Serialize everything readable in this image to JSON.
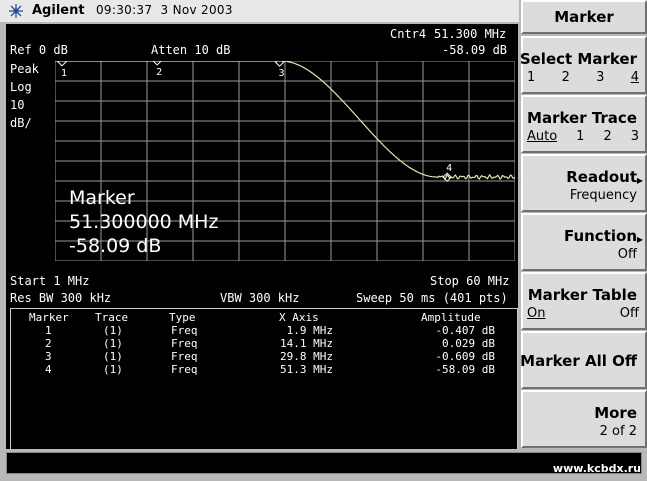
{
  "header": {
    "brand": "Agilent",
    "time": "09:30:37",
    "date": "3 Nov 2003"
  },
  "display": {
    "ref_level": "Ref 0 dB",
    "atten": "Atten 10 dB",
    "scale_type": "Peak",
    "scale_mode": "Log",
    "scale_value": "10",
    "scale_unit": "dB/",
    "active_marker_label": "Cntr4",
    "active_marker_freq": "51.300 MHz",
    "active_marker_amp": "-58.09 dB",
    "marker_readout_title": "Marker",
    "marker_readout_freq": "51.300000 MHz",
    "marker_readout_amp": "-58.09 dB",
    "start_freq": "Start 1 MHz",
    "stop_freq": "Stop 60 MHz",
    "res_bw": "Res BW 300 kHz",
    "vbw": "VBW 300 kHz",
    "sweep": "Sweep 50 ms (401 pts)",
    "marker_labels": [
      "1",
      "2",
      "3",
      "4"
    ],
    "trace_color": "#e6e6a0",
    "grid_color": "#9a9a9a"
  },
  "marker_table": {
    "headers": [
      "Marker",
      "Trace",
      "Type",
      "X Axis",
      "Amplitude"
    ],
    "rows": [
      [
        "1",
        "(1)",
        "Freq",
        "1.9 MHz",
        "-0.407 dB"
      ],
      [
        "2",
        "(1)",
        "Freq",
        "14.1 MHz",
        "0.029 dB"
      ],
      [
        "3",
        "(1)",
        "Freq",
        "29.8 MHz",
        "-0.609 dB"
      ],
      [
        "4",
        "(1)",
        "Freq",
        "51.3 MHz",
        "-58.09 dB"
      ]
    ]
  },
  "softkeys": {
    "menu_title": "Marker",
    "select_marker": {
      "title": "Select Marker",
      "options": [
        "1",
        "2",
        "3",
        "4"
      ],
      "selected": "4"
    },
    "marker_trace": {
      "title": "Marker Trace",
      "options": [
        "Auto",
        "1",
        "2",
        "3"
      ],
      "selected": "Auto"
    },
    "readout": {
      "title": "Readout",
      "value": "Frequency"
    },
    "function": {
      "title": "Function",
      "value": "Off"
    },
    "marker_table": {
      "title": "Marker Table",
      "on": "On",
      "off": "Off"
    },
    "marker_all_off": {
      "title": "Marker All Off"
    },
    "more": {
      "title": "More",
      "value": "2 of 2"
    }
  },
  "watermark": "www.kcbdx.ru"
}
